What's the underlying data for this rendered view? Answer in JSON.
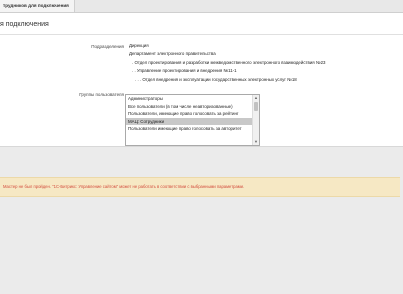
{
  "tab": {
    "label": "трудников для подключения"
  },
  "page": {
    "title": "я подключения"
  },
  "form": {
    "departments_label": "Подразделения",
    "groups_label": "Группы пользователя",
    "departments": [
      {
        "label": "Дирекция",
        "level": 0
      },
      {
        "label": "Департамент электронного правительства",
        "level": 1
      },
      {
        "label": ". Отдел проектирования и разработки межведомственного электронного взаимодействия №23",
        "level": 2
      },
      {
        "label": ". . Управление проектирования и внедрения №11-1",
        "level": 2
      },
      {
        "label": ". . . Отдел внедрения и эксплуатации государственных электронных услуг №18",
        "level": 3
      }
    ],
    "groups": [
      {
        "label": "Администраторы",
        "selected": false
      },
      {
        "label": "Все пользователи (в том числе неавторизованные)",
        "selected": false
      },
      {
        "label": "Пользователи, имеющие право голосовать за рейтинг",
        "selected": false
      },
      {
        "label": "МАЦ: Сотрудники",
        "selected": true
      },
      {
        "label": "Пользователи имеющие право голосовать за авторитет",
        "selected": false
      }
    ]
  },
  "warning": {
    "text": "Мастер не был пройден. \"1С-Битрикс: Управление сайтом\" может не работать в соответствии с выбранными параметрами."
  },
  "colors": {
    "warning_text": "#d24b3c",
    "warning_bg": "#f6e8c4",
    "selected_bg": "#c8c8c8"
  }
}
